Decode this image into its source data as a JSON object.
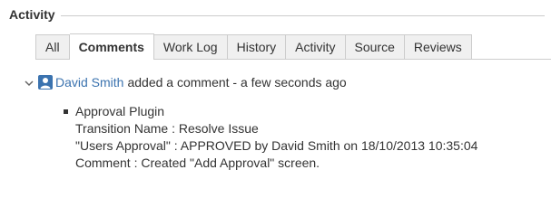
{
  "section": {
    "title": "Activity"
  },
  "tabs": [
    {
      "label": "All",
      "active": false
    },
    {
      "label": "Comments",
      "active": true
    },
    {
      "label": "Work Log",
      "active": false
    },
    {
      "label": "History",
      "active": false
    },
    {
      "label": "Activity",
      "active": false
    },
    {
      "label": "Source",
      "active": false
    },
    {
      "label": "Reviews",
      "active": false
    }
  ],
  "activity": {
    "author": "David Smith",
    "action": "added a comment - a few seconds ago"
  },
  "comment": {
    "bullet_text": "Approval Plugin",
    "lines": [
      "Transition Name : Resolve Issue",
      "\"Users Approval\" : APPROVED by David Smith on 18/10/2013 10:35:04",
      "Comment : Created \"Add Approval\" screen."
    ]
  },
  "colors": {
    "link": "#3b73af",
    "tab_bg": "#f0f0f0",
    "border": "#cccccc"
  }
}
